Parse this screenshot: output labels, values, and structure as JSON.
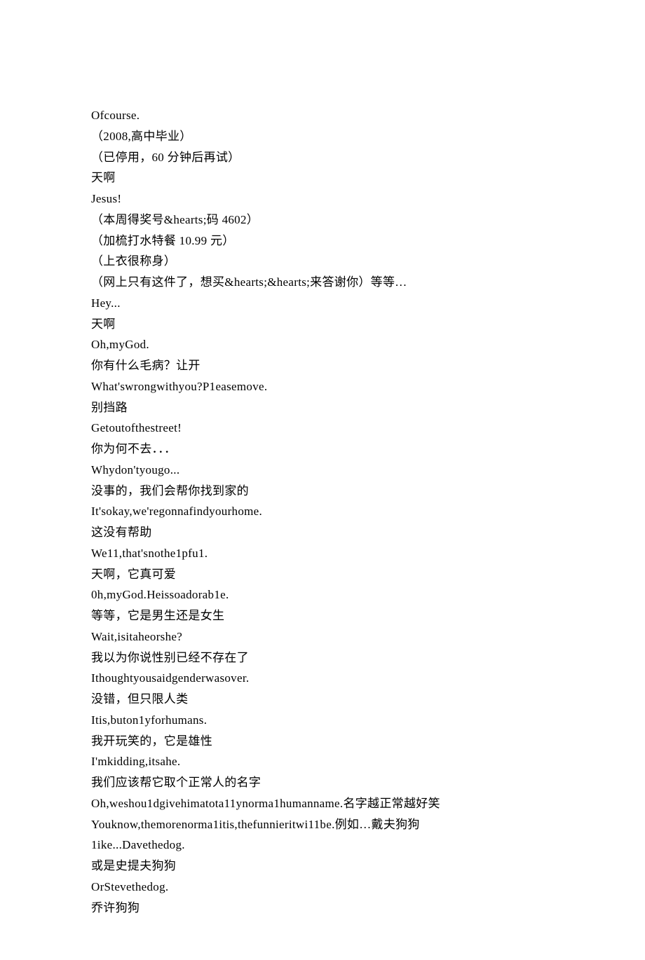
{
  "lines": [
    "Ofcourse.",
    "（2008,高中毕业）",
    "（已停用，60 分钟后再试）",
    "天啊",
    "Jesus!",
    "（本周得奖号&hearts;码 4602）",
    "（加梳打水特餐 10.99 元）",
    "（上衣很称身）",
    "（网上只有这件了，想买&hearts;&hearts;来答谢你）等等…",
    "Hey...",
    "天啊",
    "Oh,myGod.",
    "你有什么毛病？让开",
    "What'swrongwithyou?P1easemove.",
    "别挡路",
    "Getoutofthestreet!",
    "你为何不去．．．",
    "Whydon'tyougo...",
    "没事的，我们会帮你找到家的",
    "It'sokay,we'regonnafindyourhome.",
    "这没有帮助",
    "We11,that'snothe1pfu1.",
    "天啊，它真可爱",
    "0h,myGod.Heissoadorab1e.",
    "等等，它是男生还是女生",
    "Wait,isitaheorshe?",
    "我以为你说性别已经不存在了",
    "Ithoughtyousaidgenderwasover.",
    "没错，但只限人类",
    "Itis,buton1yforhumans.",
    "我开玩笑的，它是雄性",
    "I'mkidding,itsahe.",
    "我们应该帮它取个正常人的名字",
    "Oh,weshou1dgivehimatota11ynorma1humanname.名字越正常越好笑",
    "Youknow,themorenorma1itis,thefunnieritwi11be.例如…戴夫狗狗",
    "1ike...Davethedog.",
    "或是史提夫狗狗",
    "OrStevethedog.",
    "乔许狗狗"
  ]
}
